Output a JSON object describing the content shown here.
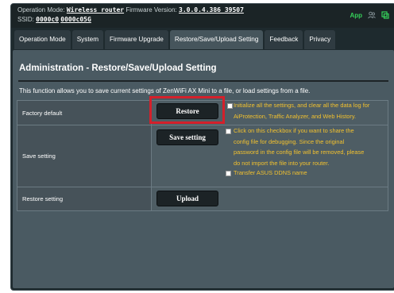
{
  "topbar": {
    "op_mode_label": "Operation Mode:",
    "op_mode_value": "Wireless router",
    "firmware_label": "Firmware Version:",
    "firmware_value": "3.0.0.4.386 39507",
    "ssid_label": "SSID:",
    "ssid_1": "0000c0",
    "ssid_2": "0000c05G",
    "app_label": "App"
  },
  "tabs": [
    {
      "label": "Operation Mode"
    },
    {
      "label": "System"
    },
    {
      "label": "Firmware Upgrade"
    },
    {
      "label": "Restore/Save/Upload Setting",
      "active": true
    },
    {
      "label": "Feedback"
    },
    {
      "label": "Privacy"
    }
  ],
  "page": {
    "title": "Administration - Restore/Save/Upload Setting",
    "intro": "This function allows you to save current settings of ZenWiFi AX Mini to a file, or load settings from a file."
  },
  "rows": {
    "factory": {
      "label": "Factory default",
      "button": "Restore",
      "option_line1": "Initialize all the settings, and clear all the data log for",
      "option_line2": "AiProtection, Traffic Analyzer, and Web History."
    },
    "save": {
      "label": "Save setting",
      "button": "Save setting",
      "option_line1": "Click on this checkbox if you want to share the",
      "option_line2": "config file for debugging. Since the original",
      "option_line3": "password in the config file will be removed, please",
      "option_line4": "do not import the file into your router.",
      "ddns_label": "Transfer ASUS DDNS name"
    },
    "restore": {
      "label": "Restore setting",
      "button": "Upload"
    }
  },
  "colors": {
    "highlight": "#d4202b",
    "warning_text": "#f2c12e",
    "app_green": "#35d15a"
  }
}
